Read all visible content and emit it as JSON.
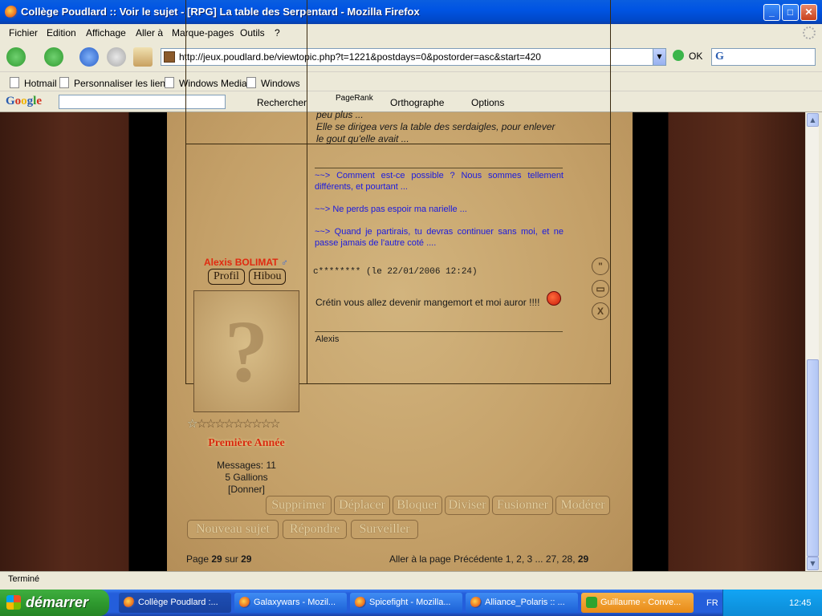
{
  "window": {
    "title": "Collège Poudlard :: Voir le sujet - [RPG] La table des Serpentard - Mozilla Firefox"
  },
  "menu": [
    "Fichier",
    "Edition",
    "Affichage",
    "Aller à",
    "Marque-pages",
    "Outils",
    "?"
  ],
  "nav": {
    "url": "http://jeux.poudlard.be/viewtopic.php?t=1221&postdays=0&postorder=asc&start=420",
    "go_label": "OK"
  },
  "bookmarks": [
    "Hotmail",
    "Personnaliser les liens",
    "Windows Media",
    "Windows"
  ],
  "google_toolbar": {
    "logo": "Google",
    "search_label": "Rechercher",
    "pagerank_label": "PageRank",
    "spell_label": "Orthographe",
    "options_label": "Options"
  },
  "previous_post": {
    "text_line1": "peu plus ...",
    "text_line2": "Elle se dirigea vers la table des serdaigles, pour enlever",
    "text_line3": "le gout qu'elle avait ...",
    "signature": [
      "~~> Comment est-ce possible ? Nous sommes tellement différents, et pourtant ...",
      "~~> Ne perds pas espoir ma narielle ...",
      "~~> Quand je partirais, tu devras continuer sans moi, et ne passe jamais de l'autre coté ...."
    ]
  },
  "post": {
    "author": "Alexis BOLIMAT",
    "gender_icon": "male-icon",
    "profile_button": "Profil",
    "owl_button": "Hibou",
    "rank": "Première Année",
    "messages": "Messages: 11",
    "gallions": "5 Gallions",
    "give": "[Donner]",
    "header": "c******** (le 22/01/2006 12:24)",
    "message": "Crétin vous allez devenir mangemort et moi auror !!!!",
    "smiley": "angry-smiley-icon",
    "signature": "Alexis",
    "stars_total": 10,
    "stars_filled": 1
  },
  "moderation": {
    "buttons": [
      "Supprimer",
      "Déplacer",
      "Bloquer",
      "Diviser",
      "Fusionner",
      "Modérer"
    ]
  },
  "actions": {
    "buttons": [
      "Nouveau sujet",
      "Répondre",
      "Surveiller"
    ]
  },
  "pagination": {
    "label_page": "Page",
    "current": "29",
    "label_sur": "sur",
    "total": "29",
    "goto_label": "Aller à la page",
    "prev": "Précédente",
    "pages": "1, 2, 3 ... 27, 28,",
    "last": "29"
  },
  "status": "Terminé",
  "taskbar": {
    "start": "démarrer",
    "tasks": [
      "Collège Poudlard :...",
      "Galaxywars - Mozil...",
      "Spicefight - Mozilla...",
      "Alliance_Polaris :: ...",
      "Guillaume - Conve..."
    ],
    "lang": "FR",
    "clock": "12:45"
  }
}
